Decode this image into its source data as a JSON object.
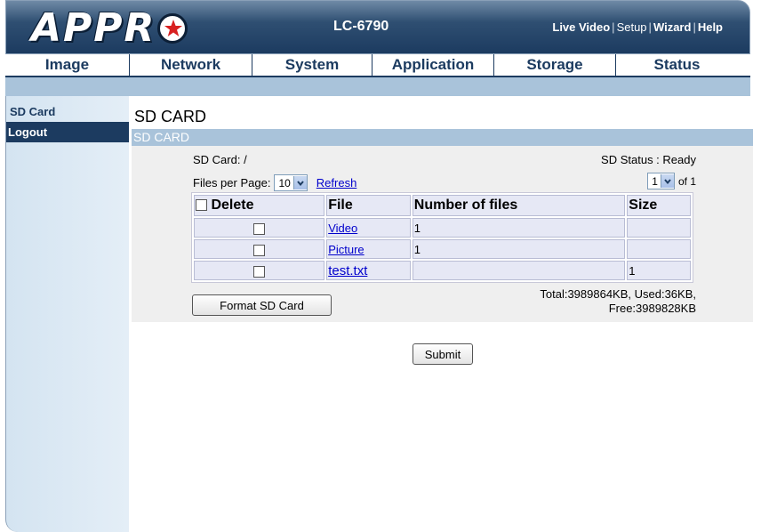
{
  "header": {
    "logo": "APPRO",
    "model": "LC-6790",
    "links": {
      "live_video": "Live Video",
      "setup": "Setup",
      "wizard": "Wizard",
      "help": "Help",
      "separator": "|"
    }
  },
  "nav": {
    "tabs": [
      "Image",
      "Network",
      "System",
      "Application",
      "Storage",
      "Status"
    ]
  },
  "sidebar": {
    "items": [
      {
        "label": "SD Card",
        "active": false
      },
      {
        "label": "Logout",
        "active": true
      }
    ]
  },
  "main": {
    "title": "SD CARD",
    "section": "SD CARD",
    "sd_card_label": "SD Card: /",
    "sd_status": "SD Status : Ready",
    "files_per_page_label": "Files per Page:",
    "files_per_page_value": "10",
    "refresh": "Refresh",
    "page_value": "1",
    "page_of": "of 1",
    "table": {
      "headers": {
        "delete": "Delete",
        "file": "File",
        "count": "Number of files",
        "size": "Size"
      },
      "rows": [
        {
          "file": "Video",
          "count": "1",
          "size": ""
        },
        {
          "file": "Picture",
          "count": "1",
          "size": ""
        },
        {
          "file": "test.txt",
          "count": "",
          "size": "1"
        }
      ]
    },
    "format_button": "Format SD Card",
    "totals_line1": "Total:3989864KB, Used:36KB,",
    "totals_line2": "Free:3989828KB",
    "submit": "Submit"
  },
  "colors": {
    "header_dark": "#1c3b60",
    "subbar": "#a9c3da",
    "sidebar": "#dbe8f3",
    "link": "#0000cc"
  }
}
